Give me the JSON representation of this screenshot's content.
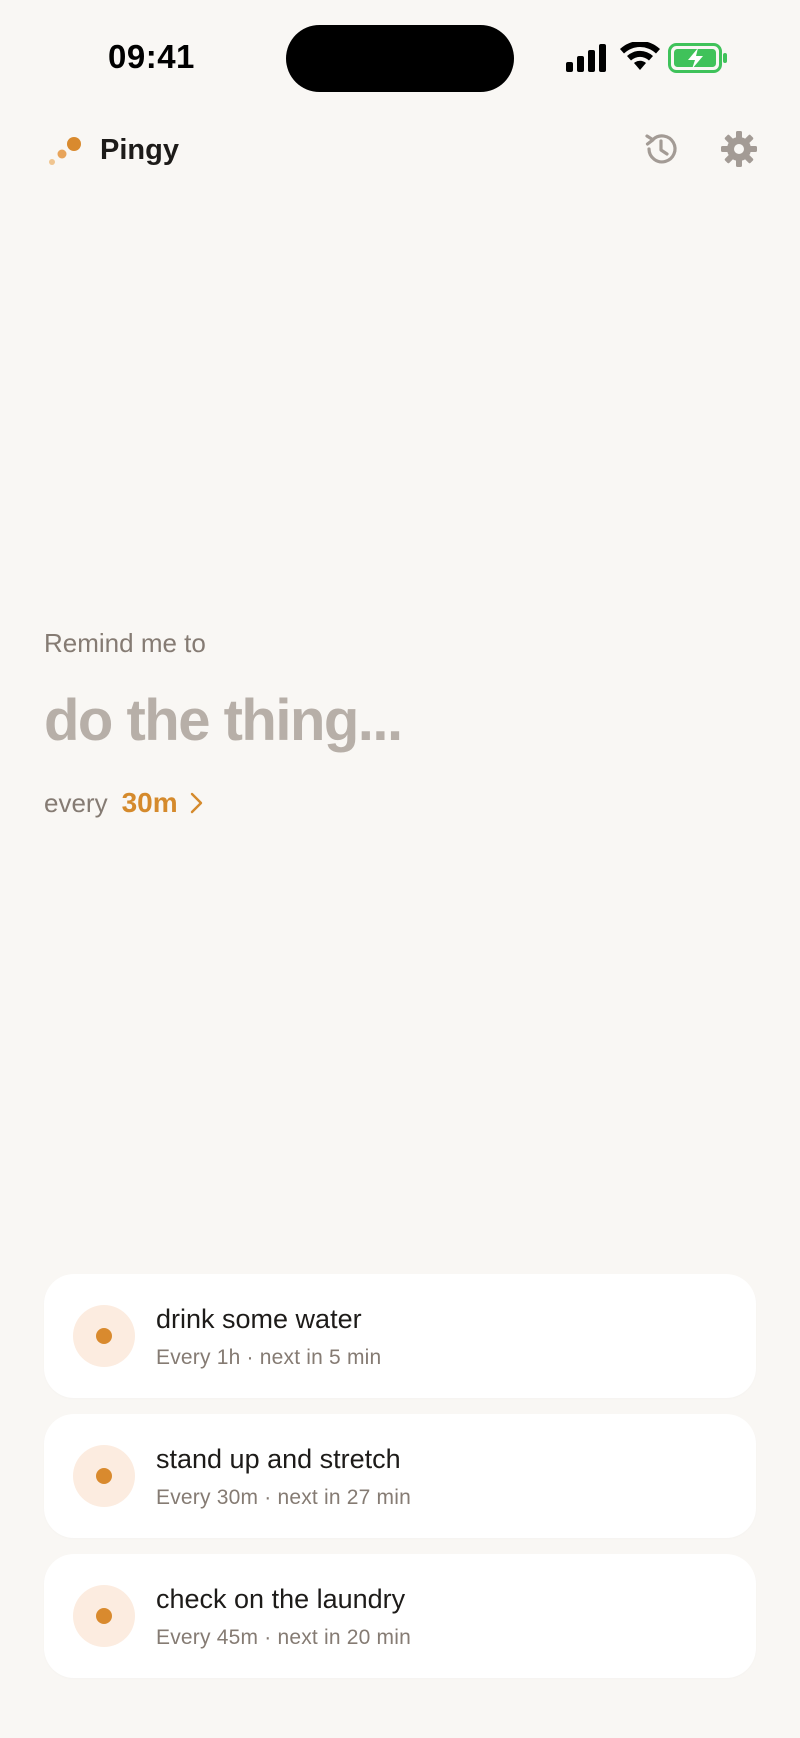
{
  "status_bar": {
    "time": "09:41",
    "icons": [
      "signal-icon",
      "wifi-icon",
      "battery-charging-icon"
    ],
    "battery_color": "#3fc25a"
  },
  "header": {
    "app_name": "Pingy",
    "logo_icon": "pingy-dots-logo",
    "actions": [
      "history-icon",
      "gear-icon"
    ]
  },
  "composer": {
    "prompt": "Remind me to",
    "placeholder": "do the thing...",
    "every_label": "every",
    "interval": "30m"
  },
  "reminders": [
    {
      "title": "drink some water",
      "interval": "Every 1h",
      "next": "next in 5 min"
    },
    {
      "title": "stand up and stretch",
      "interval": "Every 30m",
      "next": "next in 27 min"
    },
    {
      "title": "check on the laundry",
      "interval": "Every 45m",
      "next": "next in 20 min"
    }
  ],
  "colors": {
    "background": "#f9f7f4",
    "accent": "#d98a2e",
    "muted_text": "#857b73",
    "placeholder_text": "#b7afa8",
    "card": "#ffffff"
  }
}
